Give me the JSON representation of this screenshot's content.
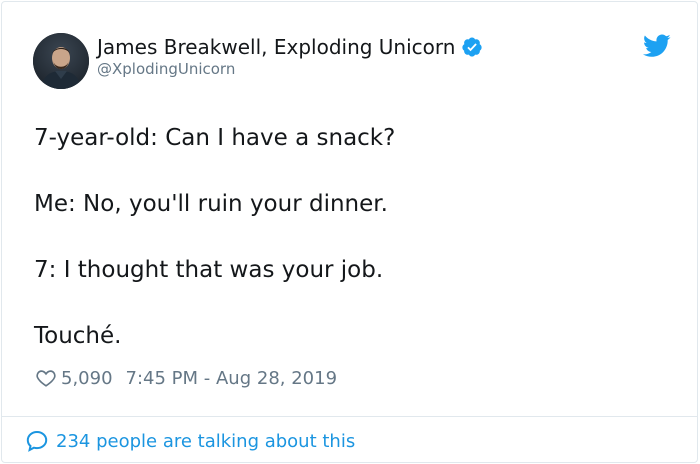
{
  "author": {
    "display_name": "James Breakwell, Exploding Unicorn",
    "handle": "@XplodingUnicorn",
    "verified_icon": "verified-badge-icon",
    "avatar_icon": "avatar"
  },
  "brand": {
    "icon": "twitter-bird-icon",
    "color": "#1da1f2"
  },
  "tweet": {
    "lines": [
      "7-year-old: Can I have a snack?",
      "Me: No, you'll ruin your dinner.",
      "7: I thought that was your job.",
      "Touché."
    ]
  },
  "meta": {
    "like_icon": "heart-icon",
    "like_count": "5,090",
    "timestamp": "7:45 PM - Aug 28, 2019"
  },
  "footer": {
    "icon": "speech-bubble-icon",
    "talking_text": "234 people are talking about this"
  },
  "colors": {
    "text_primary": "#14171a",
    "text_secondary": "#657786",
    "link": "#1b95e0",
    "border": "#e1e8ed"
  }
}
